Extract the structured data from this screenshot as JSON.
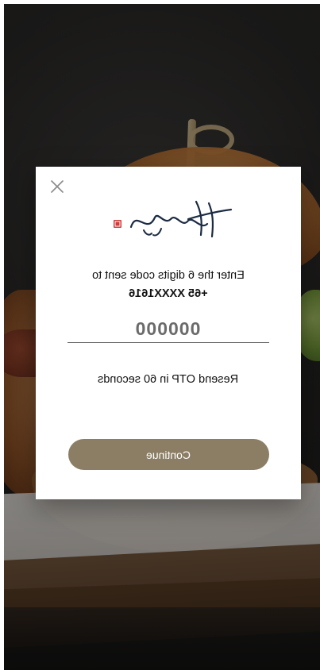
{
  "modal": {
    "logo_text": "Hervé",
    "otp_message": "Enter the 6 digits code sent to",
    "phone": "+65 XXXX1616",
    "code_placeholder": "000000",
    "resend_text": "Resend OTP in 60 seconds",
    "continue_label": "Continue"
  },
  "icons": {
    "close": "close-icon",
    "logo": "brand-logo",
    "seal": "red-seal-icon"
  },
  "colors": {
    "button_bg": "#8b7e65",
    "seal_red": "#d23a3a",
    "text": "#111111"
  }
}
